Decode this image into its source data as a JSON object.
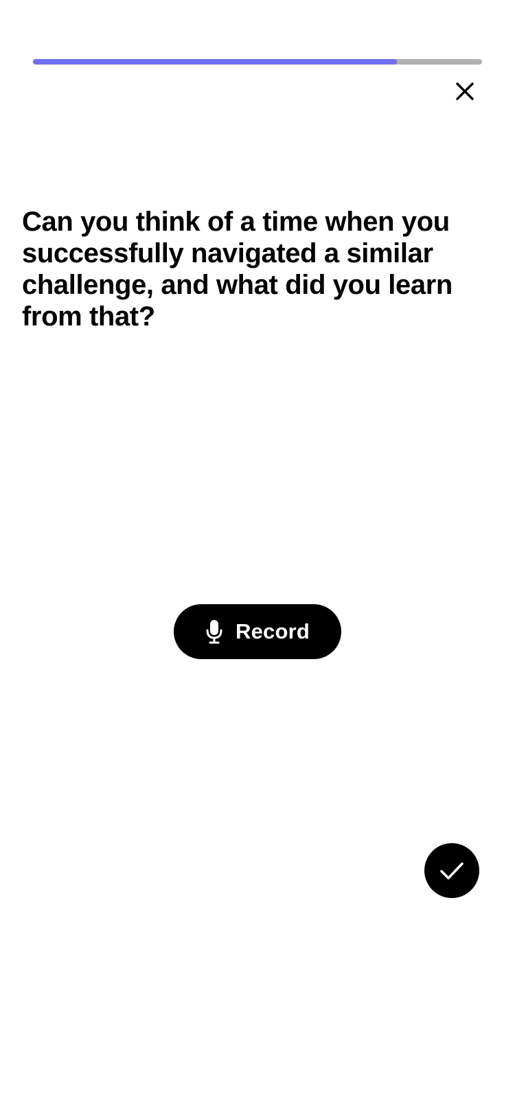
{
  "progress": {
    "value": 0.81,
    "fill_color": "#6f6ff0",
    "track_color": "#b0b0b0"
  },
  "header": {
    "close_icon": "close-icon"
  },
  "question": {
    "text": "Can you think of a time when you successfully navigated a similar challenge, and what did you learn from that?"
  },
  "record_button": {
    "label": "Record",
    "icon": "microphone-icon"
  },
  "done_button": {
    "icon": "checkmark-icon"
  }
}
